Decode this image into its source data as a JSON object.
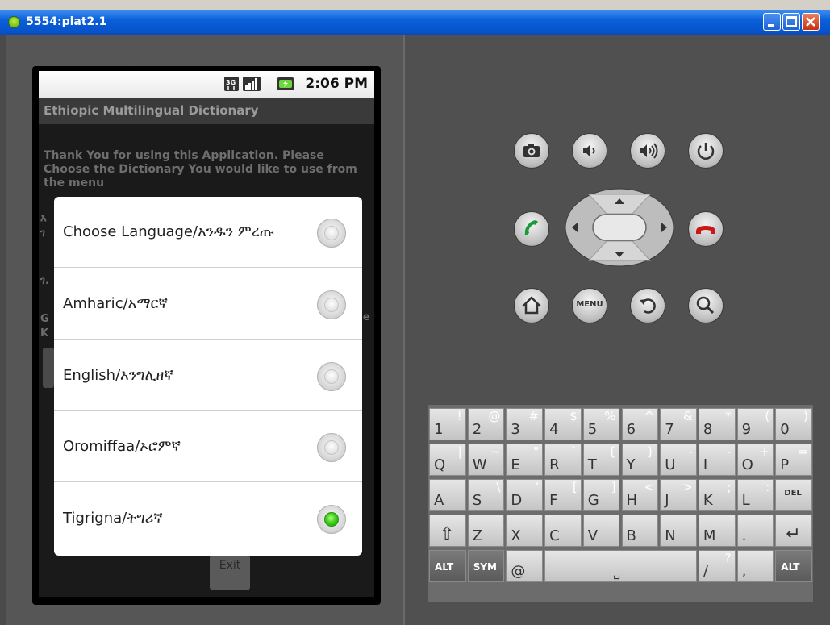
{
  "window": {
    "title": "5554:plat2.1"
  },
  "statusbar": {
    "time": "2:06 PM",
    "icons": [
      "3g-icon",
      "signal-icon",
      "battery-icon"
    ]
  },
  "app": {
    "title": "Ethiopic Multilingual Dictionary",
    "intro": "Thank You for using this Application. Please Choose the Dictionary You would like to use from the menu",
    "exit_label": "Exit"
  },
  "dialog": {
    "options": [
      {
        "label": "Choose Language/አንዱን ምረጡ",
        "checked": false
      },
      {
        "label": "Amharic/አማርኛ",
        "checked": false
      },
      {
        "label": "English/እንግሊዘኛ",
        "checked": false
      },
      {
        "label": "Oromiffaa/ኦሮምኛ",
        "checked": false
      },
      {
        "label": "Tigrigna/ትግሪኛ",
        "checked": true
      }
    ]
  },
  "controls": {
    "row1": [
      "camera-icon",
      "volume-down-icon",
      "volume-up-icon",
      "power-icon"
    ],
    "row2": [
      "call-icon",
      "dpad",
      "end-call-icon"
    ],
    "row3": [
      "home-icon",
      "menu",
      "back-icon",
      "search-icon"
    ],
    "menu_label": "MENU"
  },
  "keyboard": {
    "row1": [
      {
        "main": "1",
        "alt": "!"
      },
      {
        "main": "2",
        "alt": "@"
      },
      {
        "main": "3",
        "alt": "#"
      },
      {
        "main": "4",
        "alt": "$"
      },
      {
        "main": "5",
        "alt": "%"
      },
      {
        "main": "6",
        "alt": "^"
      },
      {
        "main": "7",
        "alt": "&"
      },
      {
        "main": "8",
        "alt": "*"
      },
      {
        "main": "9",
        "alt": "("
      },
      {
        "main": "0",
        "alt": ")"
      }
    ],
    "row2": [
      {
        "main": "Q",
        "alt": "|"
      },
      {
        "main": "W",
        "alt": "~"
      },
      {
        "main": "E",
        "alt": "\""
      },
      {
        "main": "R",
        "alt": "`"
      },
      {
        "main": "T",
        "alt": "{"
      },
      {
        "main": "Y",
        "alt": "}"
      },
      {
        "main": "U",
        "alt": "-"
      },
      {
        "main": "I",
        "alt": "-"
      },
      {
        "main": "O",
        "alt": "+"
      },
      {
        "main": "P",
        "alt": "="
      }
    ],
    "row3": [
      {
        "main": "A",
        "alt": ""
      },
      {
        "main": "S",
        "alt": "\\"
      },
      {
        "main": "D",
        "alt": "'"
      },
      {
        "main": "F",
        "alt": "["
      },
      {
        "main": "G",
        "alt": "]"
      },
      {
        "main": "H",
        "alt": "<"
      },
      {
        "main": "J",
        "alt": ">"
      },
      {
        "main": "K",
        "alt": ";"
      },
      {
        "main": "L",
        "alt": ":"
      },
      {
        "main": "DEL",
        "alt": ""
      }
    ],
    "row4": [
      {
        "main": "⇧",
        "alt": ""
      },
      {
        "main": "Z",
        "alt": ""
      },
      {
        "main": "X",
        "alt": ""
      },
      {
        "main": "C",
        "alt": ""
      },
      {
        "main": "V",
        "alt": ""
      },
      {
        "main": "B",
        "alt": ""
      },
      {
        "main": "N",
        "alt": ""
      },
      {
        "main": "M",
        "alt": ""
      },
      {
        "main": ".",
        "alt": ""
      },
      {
        "main": "↵",
        "alt": ""
      }
    ],
    "row5": {
      "alt_left": "ALT",
      "sym": "SYM",
      "at": "@",
      "space": "␣",
      "slash": "/",
      "slash_alt": "?",
      "comma": ",",
      "alt_right": "ALT"
    }
  }
}
